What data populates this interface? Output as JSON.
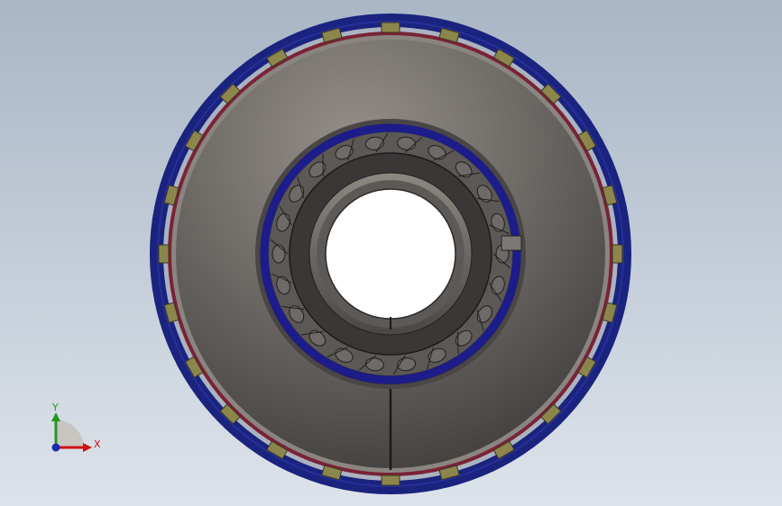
{
  "triad": {
    "x_label": "X",
    "y_label": "Y"
  },
  "colors": {
    "background_top": "#a9b6c6",
    "background_bottom": "#dde3ea",
    "outer_ring": "#1a237e",
    "red_band": "#7a2236",
    "face": "#6e6a66",
    "olive_block": "#8c864c",
    "inner_ring": "#1c1c8a",
    "bore": "#ffffff",
    "x_axis": "#cc1111",
    "y_axis": "#1f9a1f",
    "z_axis": "#1a2bb0"
  },
  "icons": {
    "triad": "coordinate-triad-icon"
  }
}
